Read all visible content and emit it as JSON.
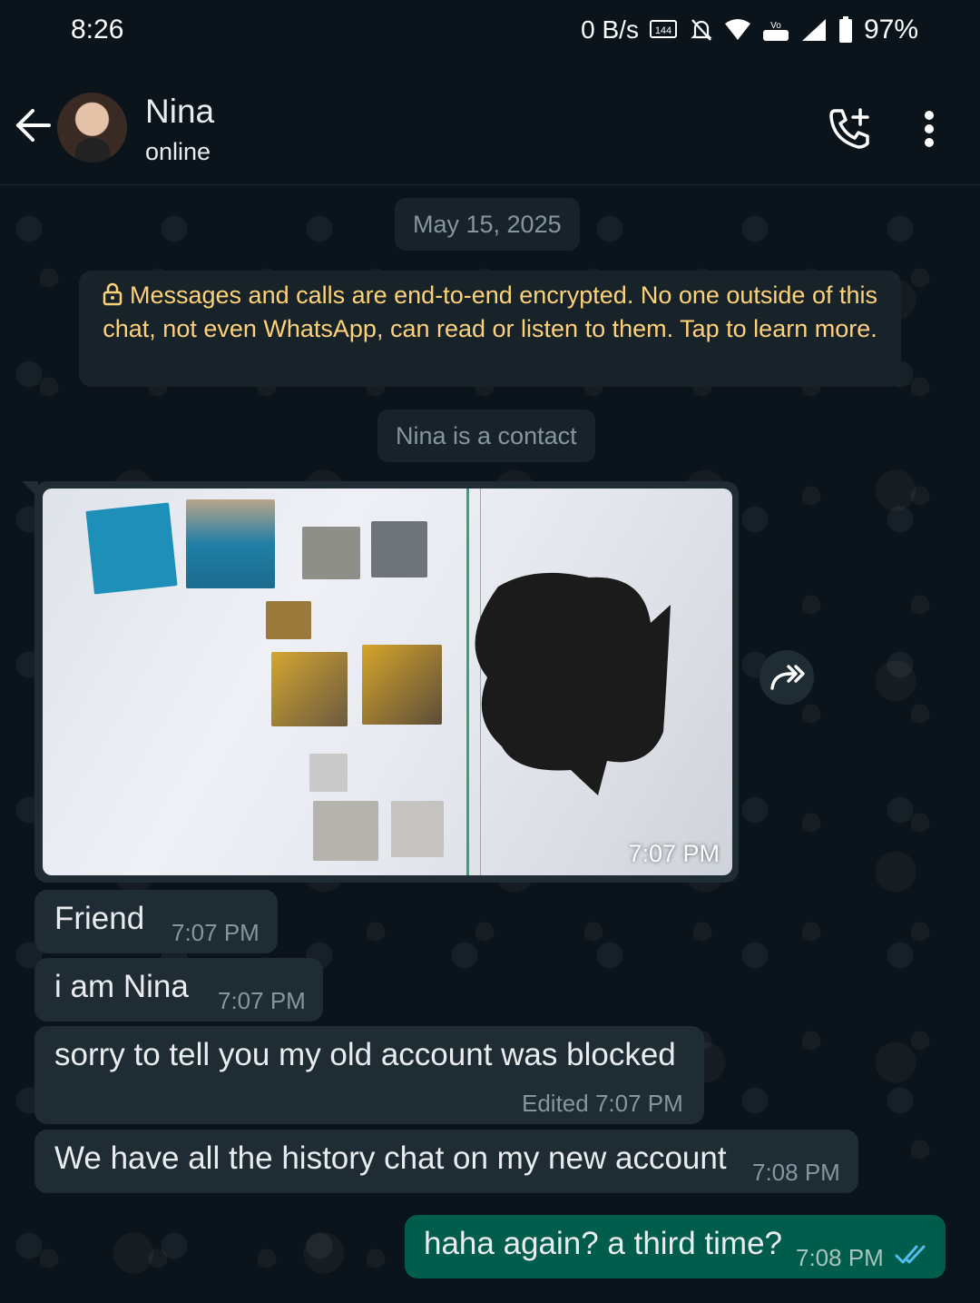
{
  "status_bar": {
    "time": "8:26",
    "net_speed": "0 B/s",
    "refresh_rate": "144",
    "battery": "97%"
  },
  "header": {
    "contact_name": "Nina",
    "presence": "online",
    "icons": [
      "back-arrow-icon",
      "add-call-icon",
      "more-vert-icon"
    ]
  },
  "chat": {
    "date_chip": "May 15, 2025",
    "e2e_notice": "Messages and calls are end-to-end encrypted. No one outside of this chat, not even WhatsApp, can read or listen to them. Tap to learn more.",
    "contact_chip": "Nina is a contact",
    "messages": [
      {
        "type": "image",
        "direction": "in",
        "time": "7:07 PM"
      },
      {
        "type": "text",
        "direction": "in",
        "text": "Friend",
        "time": "7:07 PM"
      },
      {
        "type": "text",
        "direction": "in",
        "text": "i am Nina",
        "time": "7:07 PM"
      },
      {
        "type": "text",
        "direction": "in",
        "text": "sorry to tell you my old account was blocked",
        "time": "Edited 7:07 PM"
      },
      {
        "type": "text",
        "direction": "in",
        "text": "We have all the history chat on my new account",
        "time": "7:08 PM"
      },
      {
        "type": "text",
        "direction": "out",
        "text": "haha again? a third time?",
        "time": "7:08 PM",
        "status": "read"
      }
    ]
  },
  "colors": {
    "background": "#0b141a",
    "incoming_bubble": "#1f2c34",
    "outgoing_bubble": "#005c4b",
    "system_text": "#ffd279",
    "read_ticks": "#53bdeb"
  }
}
